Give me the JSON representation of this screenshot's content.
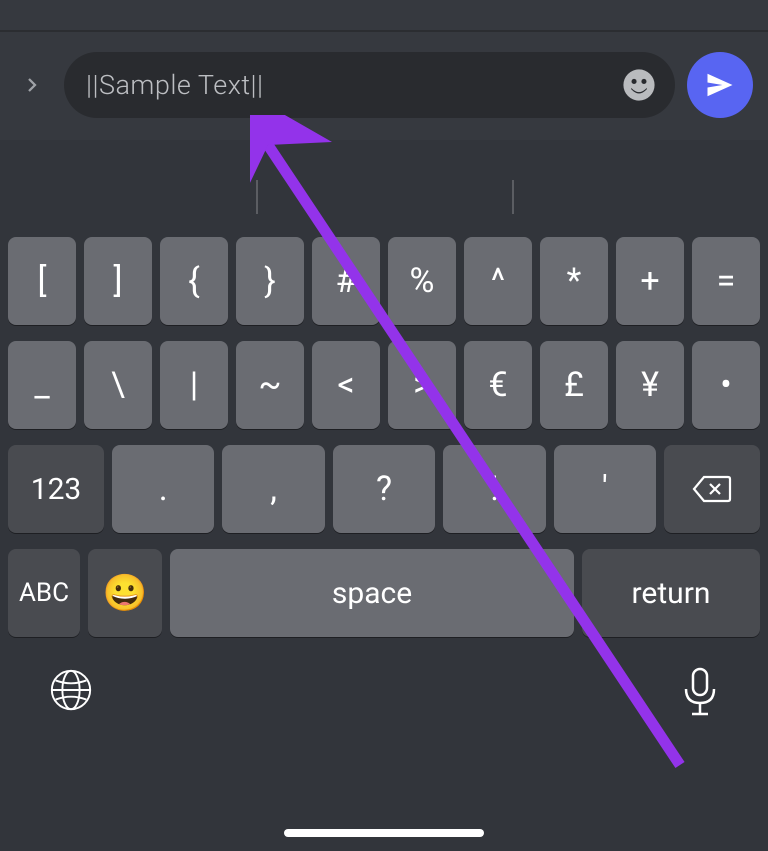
{
  "input": {
    "text": "||Sample Text||"
  },
  "keyboard": {
    "row1": [
      "[",
      "]",
      "{",
      "}",
      "#",
      "%",
      "^",
      "*",
      "+",
      "="
    ],
    "row2": [
      "_",
      "\\",
      "|",
      "~",
      "<",
      ">",
      "€",
      "£",
      "¥",
      "•"
    ],
    "row3": {
      "switch": "123",
      "keys": [
        ".",
        ",",
        "?",
        "!",
        "'"
      ]
    },
    "row4": {
      "abc": "ABC",
      "emoji": "😀",
      "space": "space",
      "return": "return"
    }
  }
}
